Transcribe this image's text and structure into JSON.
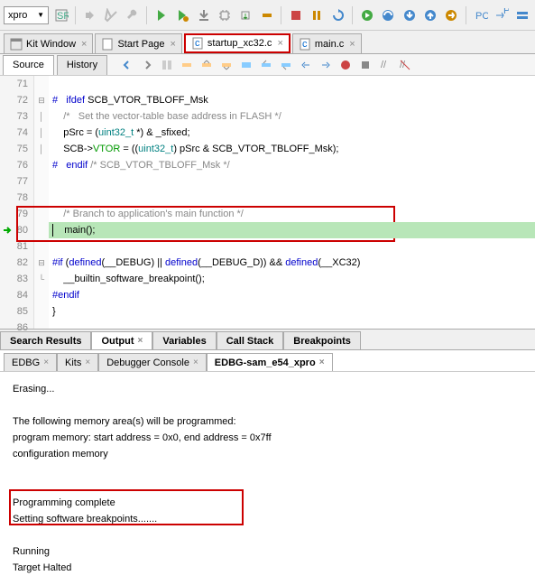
{
  "toolbar": {
    "combo_value": "xpro"
  },
  "file_tabs": [
    {
      "label": "Kit Window",
      "icon": "window"
    },
    {
      "label": "Start Page",
      "icon": "page"
    },
    {
      "label": "startup_xc32.c",
      "icon": "c-file",
      "highlight": true
    },
    {
      "label": "main.c",
      "icon": "c-file"
    }
  ],
  "editor_tabs": {
    "source": "Source",
    "history": "History"
  },
  "code_lines": [
    {
      "n": 71,
      "fold": "",
      "segs": []
    },
    {
      "n": 72,
      "fold": "⊟",
      "segs": [
        {
          "t": "#   ",
          "c": "kw-blue"
        },
        {
          "t": "ifdef",
          "c": "kw-blue"
        },
        {
          "t": " SCB_VTOR_TBLOFF_Msk",
          "c": ""
        }
      ]
    },
    {
      "n": 73,
      "fold": "|",
      "segs": [
        {
          "t": "    ",
          "c": ""
        },
        {
          "t": "/*   Set the vector-table base address in FLASH */",
          "c": "kw-gray"
        }
      ]
    },
    {
      "n": 74,
      "fold": "|",
      "segs": [
        {
          "t": "    pSrc = (",
          "c": ""
        },
        {
          "t": "uint32_t",
          "c": "kw-teal"
        },
        {
          "t": " *) & _sfixed;",
          "c": ""
        }
      ]
    },
    {
      "n": 75,
      "fold": "|",
      "segs": [
        {
          "t": "    SCB->",
          "c": ""
        },
        {
          "t": "VTOR",
          "c": "kw-green"
        },
        {
          "t": " = ((",
          "c": ""
        },
        {
          "t": "uint32_t",
          "c": "kw-teal"
        },
        {
          "t": ") pSrc & SCB_VTOR_TBLOFF_Msk);",
          "c": ""
        }
      ]
    },
    {
      "n": 76,
      "fold": "",
      "segs": [
        {
          "t": "#   ",
          "c": "kw-blue"
        },
        {
          "t": "endif",
          "c": "kw-blue"
        },
        {
          "t": " ",
          "c": ""
        },
        {
          "t": "/* SCB_VTOR_TBLOFF_Msk */",
          "c": "kw-gray"
        }
      ]
    },
    {
      "n": 77,
      "fold": "",
      "segs": []
    },
    {
      "n": 78,
      "fold": "",
      "segs": []
    },
    {
      "n": 79,
      "fold": "",
      "segs": [
        {
          "t": "    ",
          "c": ""
        },
        {
          "t": "/* Branch to application's main function */",
          "c": "kw-gray"
        }
      ]
    },
    {
      "n": 80,
      "fold": "",
      "current": true,
      "segs": [
        {
          "t": "    main();",
          "c": ""
        }
      ]
    },
    {
      "n": 81,
      "fold": "",
      "segs": []
    },
    {
      "n": 82,
      "fold": "⊟",
      "segs": [
        {
          "t": "#if",
          "c": "kw-blue"
        },
        {
          "t": " (",
          "c": ""
        },
        {
          "t": "defined",
          "c": "kw-blue"
        },
        {
          "t": "(__DEBUG) || ",
          "c": ""
        },
        {
          "t": "defined",
          "c": "kw-blue"
        },
        {
          "t": "(__DEBUG_D)) && ",
          "c": ""
        },
        {
          "t": "defined",
          "c": "kw-blue"
        },
        {
          "t": "(__XC32)",
          "c": ""
        }
      ]
    },
    {
      "n": 83,
      "fold": "└",
      "segs": [
        {
          "t": "    __builtin_software_breakpoint();",
          "c": ""
        }
      ]
    },
    {
      "n": 84,
      "fold": "",
      "segs": [
        {
          "t": "#endif",
          "c": "kw-blue"
        }
      ]
    },
    {
      "n": 85,
      "fold": "",
      "segs": [
        {
          "t": "}",
          "c": ""
        }
      ]
    },
    {
      "n": 86,
      "fold": "",
      "segs": []
    }
  ],
  "bottom_tabs": [
    {
      "label": "Search Results"
    },
    {
      "label": "Output",
      "active": true
    },
    {
      "label": "Variables"
    },
    {
      "label": "Call Stack"
    },
    {
      "label": "Breakpoints"
    }
  ],
  "output_tabs": [
    {
      "label": "EDBG"
    },
    {
      "label": "Kits"
    },
    {
      "label": "Debugger Console"
    },
    {
      "label": "EDBG-sam_e54_xpro",
      "active": true
    }
  ],
  "console": {
    "l1": "Erasing...",
    "l2": "",
    "l3": "The following memory area(s) will be programmed:",
    "l4": "program memory: start address = 0x0, end address = 0x7ff",
    "l5": "configuration memory",
    "l6": "",
    "l7": "",
    "l8": "Programming complete",
    "l9": "Setting software breakpoints.......",
    "l10": "",
    "l11": "Running",
    "l12": "Target Halted"
  }
}
